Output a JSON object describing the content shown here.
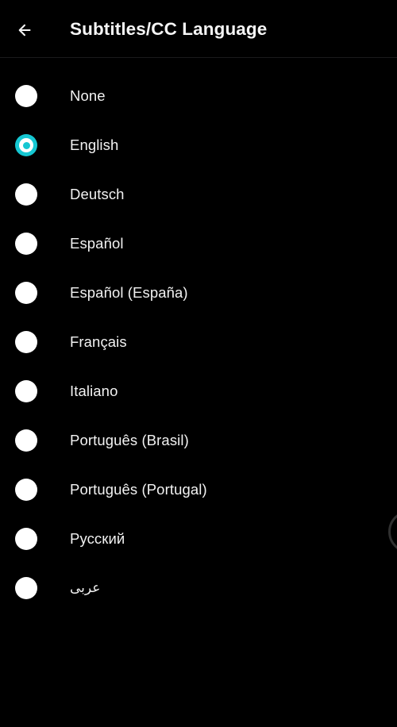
{
  "theme": {
    "background": "#000000",
    "text_color": "#f2f2f2",
    "accent": "#15c7d2",
    "divider": "#1a1a1c"
  },
  "header": {
    "title": "Subtitles/CC Language",
    "back_icon": "arrow-left-icon",
    "back_label": "Back"
  },
  "list": {
    "selected_index": 1,
    "items": [
      {
        "label": "None",
        "selected": false,
        "rtl": false
      },
      {
        "label": "English",
        "selected": true,
        "rtl": false
      },
      {
        "label": "Deutsch",
        "selected": false,
        "rtl": false
      },
      {
        "label": "Español",
        "selected": false,
        "rtl": false
      },
      {
        "label": "Español (España)",
        "selected": false,
        "rtl": false
      },
      {
        "label": "Français",
        "selected": false,
        "rtl": false
      },
      {
        "label": "Italiano",
        "selected": false,
        "rtl": false
      },
      {
        "label": "Português (Brasil)",
        "selected": false,
        "rtl": false
      },
      {
        "label": "Português (Portugal)",
        "selected": false,
        "rtl": false
      },
      {
        "label": "Русский",
        "selected": false,
        "rtl": false
      },
      {
        "label": "عربى",
        "selected": false,
        "rtl": true
      }
    ]
  },
  "edge": {
    "indicator_icon": "circle-outline-icon"
  }
}
